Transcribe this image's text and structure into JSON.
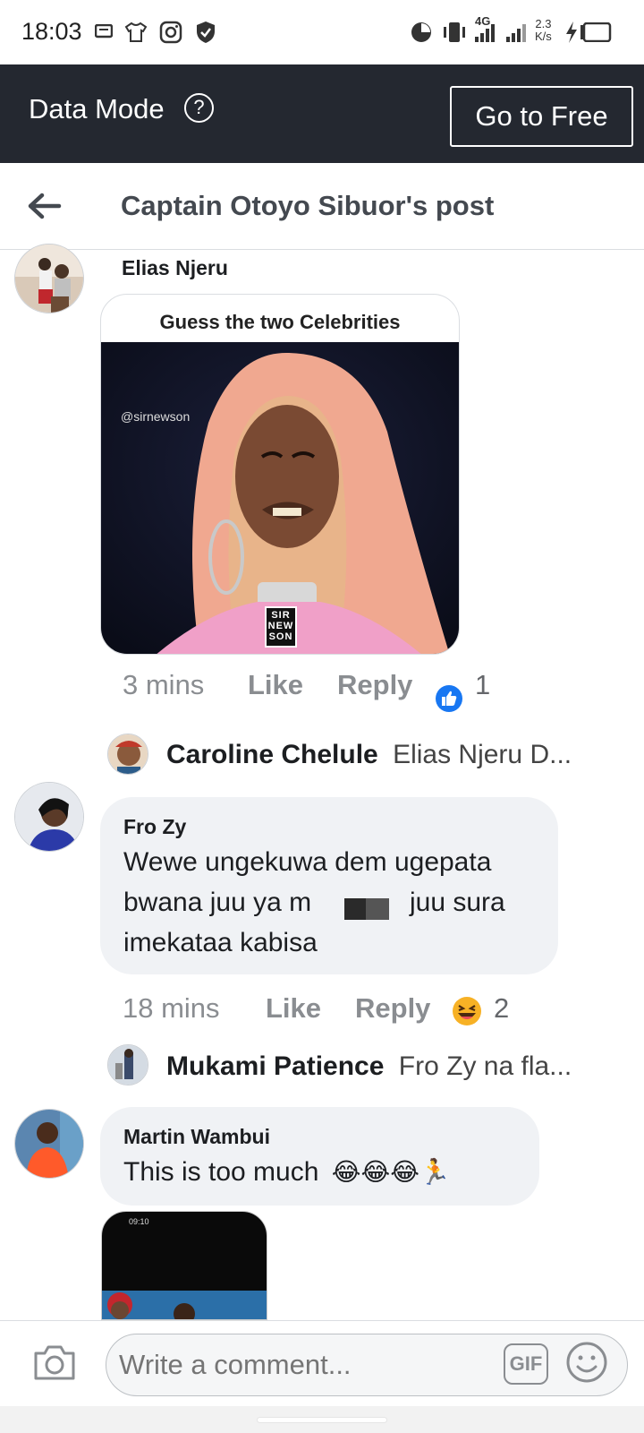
{
  "status_bar": {
    "time": "18:03",
    "net_label": "4G",
    "speed_value": "2.3",
    "speed_unit": "K/s",
    "icons": [
      "message-icon",
      "shirt-icon",
      "instagram-icon",
      "shield-icon",
      "pie-timer-icon",
      "vibrate-icon",
      "signal-icon",
      "signal-icon-2",
      "charging-icon",
      "battery-icon"
    ]
  },
  "data_mode": {
    "title": "Data Mode",
    "help_glyph": "?",
    "button_label": "Go to Free"
  },
  "header": {
    "title": "Captain Otoyo Sibuor's post"
  },
  "comments": [
    {
      "name": "Elias Njeru",
      "image_caption": "Guess the two Celebrities",
      "image_watermark": "@sirnewson",
      "image_logo": [
        "SIR",
        "NEW",
        "SON"
      ],
      "time": "3 mins",
      "like_label": "Like",
      "reply_label": "Reply",
      "reaction": "like",
      "reaction_count": "1",
      "reply": {
        "name": "Caroline Chelule",
        "preview": "Elias Njeru D..."
      }
    },
    {
      "name": "Fro Zy",
      "text_line1": "Wewe ungekuwa dem ugepata",
      "text_line2_a": "bwana juu ya m",
      "text_line2_b": "juu sura",
      "text_line3": "imekataa kabisa",
      "time": "18 mins",
      "like_label": "Like",
      "reply_label": "Reply",
      "reaction": "laughing",
      "reaction_count": "2",
      "reply": {
        "name": "Mukami Patience",
        "preview": "Fro Zy na fla..."
      }
    },
    {
      "name": "Martin Wambui",
      "text": "This is too much",
      "emoji": "😂😂😂🏃",
      "attachment_time": "09:10"
    }
  ],
  "composer": {
    "placeholder": "Write a comment...",
    "gif_label": "GIF"
  },
  "colors": {
    "dark_bar": "#242830",
    "bubble": "#f0f2f5",
    "meta_gray": "#8a8d91",
    "like_blue": "#1877f2"
  }
}
